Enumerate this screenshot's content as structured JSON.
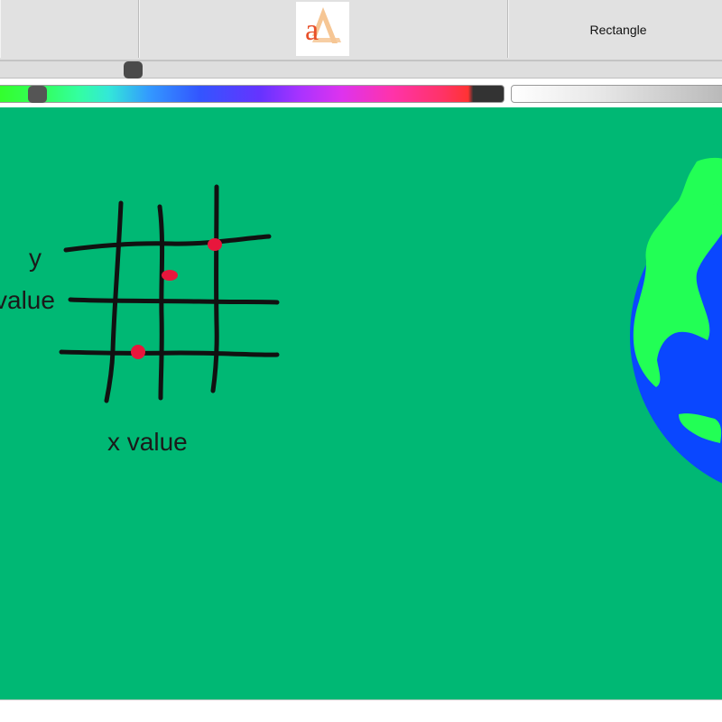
{
  "toolbar": {
    "logo_glyph": "a",
    "tool_label": "Rectangle"
  },
  "sliders": {
    "brush_size_value": 0.18,
    "color_hue_value": 0.07
  },
  "canvas": {
    "background_color": "#00b874",
    "sketch": {
      "y_label": "y",
      "y_value_label": "value",
      "x_label": "x value",
      "dot_color": "#e8163c",
      "line_color": "#111111"
    },
    "globe": {
      "ocean_color": "#0a47ff",
      "land_color": "#22ff55"
    }
  },
  "colors": {
    "toolbar_bg": "#e1e1e1",
    "logo_red": "#e8502a",
    "logo_peach": "#f6c694"
  },
  "icons": {
    "logo": "paint-app-logo-icon",
    "globe": "earth-globe-sticker"
  }
}
